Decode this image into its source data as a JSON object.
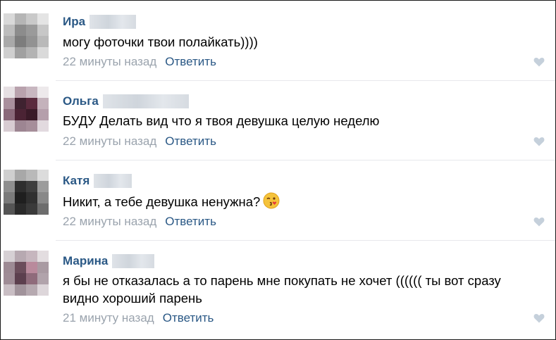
{
  "comments": [
    {
      "author": "Ира",
      "text": "могу фоточки твои полайкать))))",
      "time": "22 минуты назад",
      "reply_label": "Ответить",
      "avatar_colors": [
        "#d9d9d9",
        "#b5b5b5",
        "#c9c9c9",
        "#e4e4e4",
        "#bdbdbd",
        "#8c8c8c",
        "#9a9a9a",
        "#c7c7c7",
        "#a9a9a9",
        "#7d7d7d",
        "#929292",
        "#b9b9b9",
        "#cfcfcf",
        "#a0a0a0",
        "#b3b3b3",
        "#dadada"
      ]
    },
    {
      "author": "Ольга",
      "text": "БУДУ Делать вид что я твоя девушка целую неделю",
      "time": "22 минуты назад",
      "reply_label": "Ответить",
      "avatar_colors": [
        "#e6e0e3",
        "#b9a2ad",
        "#c8b7c0",
        "#ede9eb",
        "#a9909d",
        "#3f2230",
        "#5a2a3d",
        "#c4b2bb",
        "#8a6a7a",
        "#4b2334",
        "#3a1a28",
        "#b59fab",
        "#d8ccd2",
        "#9d8592",
        "#a68e9a",
        "#e2dadf"
      ]
    },
    {
      "author": "Катя",
      "text": "Никит, а тебе девушка ненужна?",
      "time": "22 минуты назад",
      "reply_label": "Ответить",
      "avatar_colors": [
        "#cfcfcf",
        "#a8a8a8",
        "#b9b9b9",
        "#dcdcdc",
        "#8e8e8e",
        "#2e2e2e",
        "#3e3e3e",
        "#9c9c9c",
        "#7a7a7a",
        "#1f1f1f",
        "#303030",
        "#888888",
        "#555555",
        "#2a2a2a",
        "#3a3a3a",
        "#6d6d6d"
      ]
    },
    {
      "author": "Марина",
      "text": "я бы не отказалась а то парень мне покупать не хочет (((((( ты вот сразу видно хороший парень",
      "time": "21 минуту назад",
      "reply_label": "Ответить",
      "avatar_colors": [
        "#d6d0d4",
        "#b7a9b1",
        "#c6b6be",
        "#e3dde0",
        "#9d8a94",
        "#6b4d5b",
        "#b98a9c",
        "#a99aa2",
        "#9f8c96",
        "#5c3f4e",
        "#8f6b7b",
        "#b1a3ab",
        "#c9bec4",
        "#a1939b",
        "#b6a9b0",
        "#ddd6da"
      ]
    }
  ],
  "colors": {
    "link": "#2a5885",
    "meta": "#9aa3ad",
    "heart": "#c5d0db"
  }
}
